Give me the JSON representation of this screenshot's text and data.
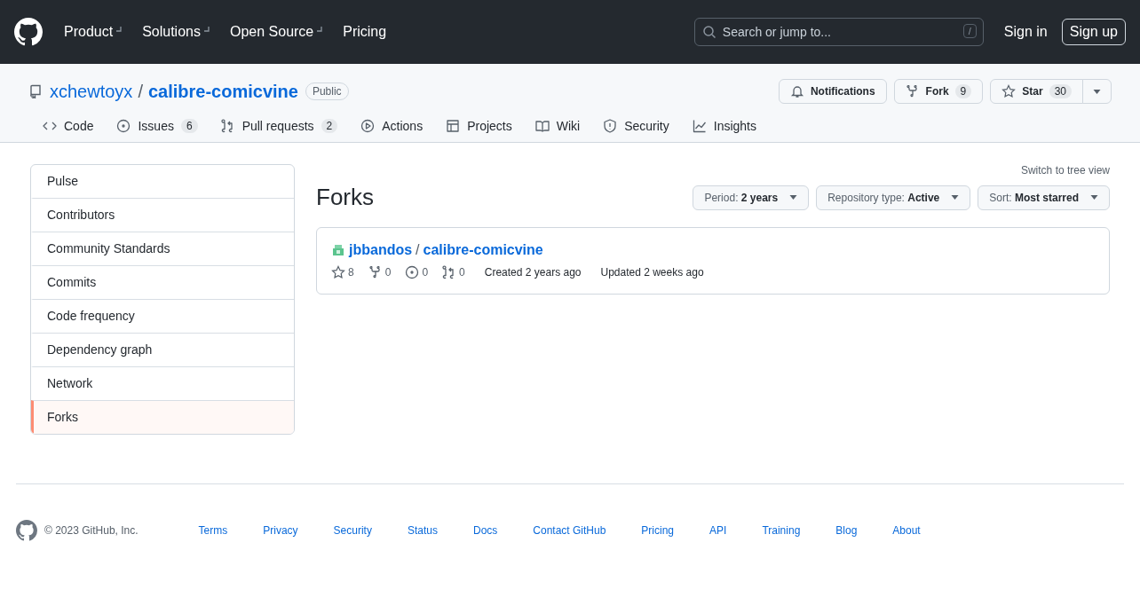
{
  "header": {
    "nav": [
      {
        "label": "Product",
        "dropdown": true
      },
      {
        "label": "Solutions",
        "dropdown": true
      },
      {
        "label": "Open Source",
        "dropdown": true
      },
      {
        "label": "Pricing",
        "dropdown": false
      }
    ],
    "search": {
      "placeholder": "Search or jump to...",
      "shortcut": "/"
    },
    "sign_in": "Sign in",
    "sign_up": "Sign up"
  },
  "repo": {
    "owner": "xchewtoyx",
    "separator": "/",
    "name": "calibre-comicvine",
    "visibility": "Public",
    "notifications": "Notifications",
    "fork": {
      "label": "Fork",
      "count": "9"
    },
    "star": {
      "label": "Star",
      "count": "30"
    }
  },
  "tabs": [
    {
      "kind": "code",
      "label": "Code"
    },
    {
      "kind": "issues",
      "label": "Issues",
      "count": "6"
    },
    {
      "kind": "pulls",
      "label": "Pull requests",
      "count": "2"
    },
    {
      "kind": "actions",
      "label": "Actions"
    },
    {
      "kind": "projects",
      "label": "Projects"
    },
    {
      "kind": "wiki",
      "label": "Wiki"
    },
    {
      "kind": "security",
      "label": "Security"
    },
    {
      "kind": "insights",
      "label": "Insights"
    }
  ],
  "sidebar": {
    "items": [
      {
        "label": "Pulse",
        "selected": false
      },
      {
        "label": "Contributors",
        "selected": false
      },
      {
        "label": "Community Standards",
        "selected": false
      },
      {
        "label": "Commits",
        "selected": false
      },
      {
        "label": "Code frequency",
        "selected": false
      },
      {
        "label": "Dependency graph",
        "selected": false
      },
      {
        "label": "Network",
        "selected": false
      },
      {
        "label": "Forks",
        "selected": true
      }
    ]
  },
  "main": {
    "switch_link": "Switch to tree view",
    "title": "Forks",
    "filters": [
      {
        "label": "Period:",
        "value": "2 years"
      },
      {
        "label": "Repository type:",
        "value": "Active"
      },
      {
        "label": "Sort:",
        "value": "Most starred"
      }
    ],
    "forks": [
      {
        "owner": "jbbandos",
        "separator": "/",
        "name": "calibre-comicvine",
        "stars": "8",
        "forks": "0",
        "issues": "0",
        "pulls": "0",
        "created": "Created 2 years ago",
        "updated": "Updated 2 weeks ago"
      }
    ]
  },
  "footer": {
    "copyright": "© 2023 GitHub, Inc.",
    "links": [
      "Terms",
      "Privacy",
      "Security",
      "Status",
      "Docs",
      "Contact GitHub",
      "Pricing",
      "API",
      "Training",
      "Blog",
      "About"
    ]
  }
}
